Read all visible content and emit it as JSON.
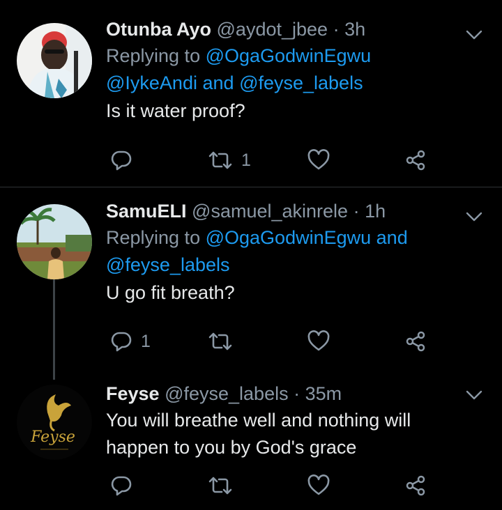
{
  "colors": {
    "background": "#000000",
    "text": "#e7e9ea",
    "muted": "#8b98a5",
    "link": "#1d9bf0",
    "divider": "#2f3336"
  },
  "icons": {
    "reply": "reply-icon",
    "retweet": "retweet-icon",
    "like": "heart-icon",
    "share": "share-icon",
    "more": "chevron-down-icon"
  },
  "tweets": [
    {
      "display_name": "Otunba Ayo",
      "handle": "@aydot_jbee",
      "separator": "·",
      "time": "3h",
      "replying_prefix": "Replying to",
      "mention_1": "@OgaGodwinEgwu",
      "mention_2": "@IykeAndi",
      "and_word": "and",
      "mention_3": "@feyse_labels",
      "text": "Is it water proof?",
      "reply_count": "",
      "retweet_count": "1",
      "like_count": ""
    },
    {
      "display_name": "SamuELI",
      "handle": "@samuel_akinrele",
      "separator": "·",
      "time": "1h",
      "replying_prefix": "Replying to",
      "mention_1": "@OgaGodwinEgwu",
      "and_word": "and",
      "mention_2": "@feyse_labels",
      "text": "U go fit breath?",
      "reply_count": "1",
      "retweet_count": "",
      "like_count": ""
    },
    {
      "display_name": "Feyse",
      "handle": "@feyse_labels",
      "separator": "·",
      "time": "35m",
      "text_line_1": "You will breathe well and nothing will",
      "text_line_2": "happen to you by God's grace",
      "reply_count": "",
      "retweet_count": "",
      "like_count": "",
      "avatar_logo_text": "Feyse"
    }
  ]
}
